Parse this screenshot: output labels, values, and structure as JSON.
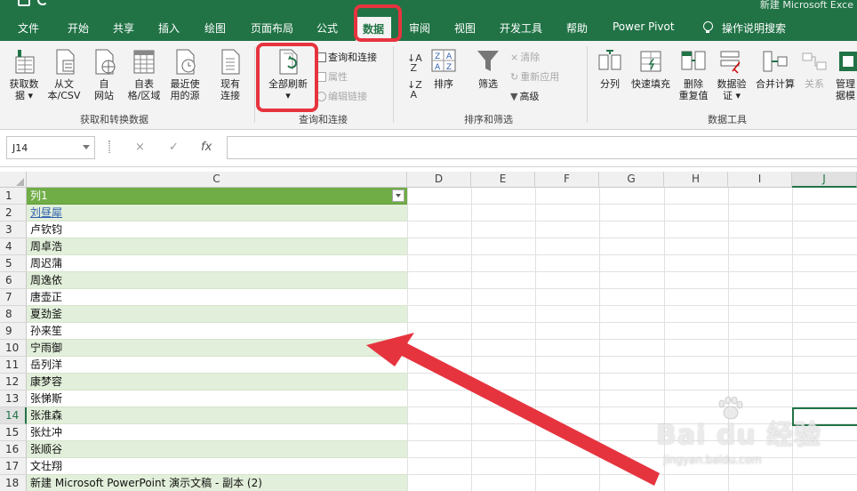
{
  "title_bar": {
    "document_title": "新建 Microsoft Exce"
  },
  "menu_tabs": [
    {
      "label": "文件",
      "active": false
    },
    {
      "label": "开始",
      "active": false
    },
    {
      "label": "共享",
      "active": false
    },
    {
      "label": "插入",
      "active": false
    },
    {
      "label": "绘图",
      "active": false
    },
    {
      "label": "页面布局",
      "active": false
    },
    {
      "label": "公式",
      "active": false
    },
    {
      "label": "数据",
      "active": true
    },
    {
      "label": "审阅",
      "active": false
    },
    {
      "label": "视图",
      "active": false
    },
    {
      "label": "开发工具",
      "active": false
    },
    {
      "label": "帮助",
      "active": false
    },
    {
      "label": "Power Pivot",
      "active": false
    }
  ],
  "tell_me": "操作说明搜索",
  "ribbon": {
    "get_data": {
      "line1": "获取数",
      "line2": "据 ▾"
    },
    "from_text": {
      "line1": "从文",
      "line2": "本/CSV"
    },
    "from_web": {
      "line1": "自",
      "line2": "网站"
    },
    "from_table": {
      "line1": "自表",
      "line2": "格/区域"
    },
    "recent": {
      "line1": "最近使",
      "line2": "用的源"
    },
    "existing": {
      "line1": "现有",
      "line2": "连接"
    },
    "group1_label": "获取和转换数据",
    "refresh_all": {
      "line1": "全部刷新",
      "line2": "▾"
    },
    "queries_connections": "查询和连接",
    "properties": "属性",
    "edit_links": "编辑链接",
    "group2_label": "查询和连接",
    "sort": "排序",
    "filter": "筛选",
    "clear": "清除",
    "reapply": "重新应用",
    "advanced": "高级",
    "group3_label": "排序和筛选",
    "text_to_columns": "分列",
    "flash_fill": {
      "line1": "快速填充",
      "line2": ""
    },
    "remove_duplicates": {
      "line1": "删除",
      "line2": "重复值"
    },
    "data_validation": {
      "line1": "数据验",
      "line2": "证 ▾"
    },
    "consolidate": "合并计算",
    "relationships": "关系",
    "manage_model": {
      "line1": "管理",
      "line2": "据模"
    },
    "group4_label": "数据工具"
  },
  "formula_bar": {
    "name_box": "J14",
    "cancel": "×",
    "enter": "✓",
    "fx": "fx"
  },
  "columns": [
    "C",
    "D",
    "E",
    "F",
    "G",
    "H",
    "I",
    "J"
  ],
  "rows": [
    {
      "n": "1",
      "value": "列1"
    },
    {
      "n": "2",
      "value": "刘昼犀"
    },
    {
      "n": "3",
      "value": "卢钦钧"
    },
    {
      "n": "4",
      "value": "周卓浩"
    },
    {
      "n": "5",
      "value": "周迟蒲"
    },
    {
      "n": "6",
      "value": "周逸依"
    },
    {
      "n": "7",
      "value": "唐壶正"
    },
    {
      "n": "8",
      "value": "夏劲釜"
    },
    {
      "n": "9",
      "value": "孙来笙"
    },
    {
      "n": "10",
      "value": "宁雨御"
    },
    {
      "n": "11",
      "value": "岳列洋"
    },
    {
      "n": "12",
      "value": "康梦容"
    },
    {
      "n": "13",
      "value": "张悌斯"
    },
    {
      "n": "14",
      "value": "张淮森"
    },
    {
      "n": "15",
      "value": "张灶冲"
    },
    {
      "n": "16",
      "value": "张顺谷"
    },
    {
      "n": "17",
      "value": "文壮翔"
    },
    {
      "n": "18",
      "value": "新建 Microsoft PowerPoint 演示文稿 - 副本 (2)"
    }
  ],
  "watermark": {
    "main": "Bai du 经验",
    "sub": "jingyan.baidu.com"
  },
  "colors": {
    "excel_green": "#217346",
    "table_header": "#70ad47",
    "band": "#e2efda",
    "highlight": "#e6343f"
  }
}
